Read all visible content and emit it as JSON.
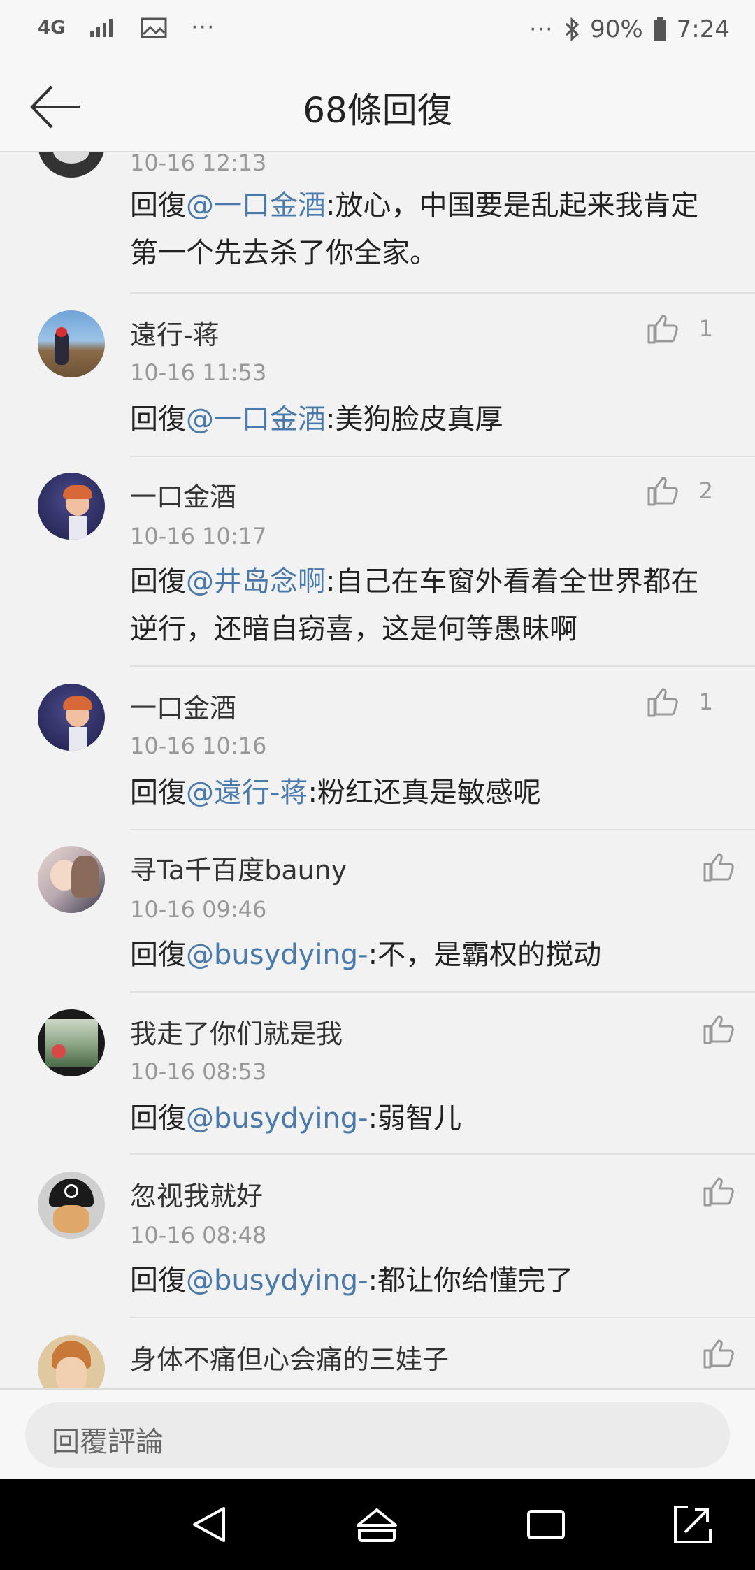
{
  "status": {
    "network": "4G",
    "left_dots": "···",
    "right_dots": "···",
    "battery": "90%",
    "time": "7:24"
  },
  "header": {
    "title": "68條回復"
  },
  "comments": [
    {
      "name": "",
      "time": "10-16 12:13",
      "reply_prefix": "回復",
      "mention": "@一口金酒",
      "text": ":放心，中国要是乱起来我肯定第一个先去杀了你全家。",
      "likes": ""
    },
    {
      "name": "遠行-蒋",
      "time": "10-16 11:53",
      "reply_prefix": "回復",
      "mention": "@一口金酒",
      "text": ":美狗脸皮真厚",
      "likes": "1"
    },
    {
      "name": "一口金酒",
      "time": "10-16 10:17",
      "reply_prefix": "回復",
      "mention": "@井岛念啊",
      "text": ":自己在车窗外看着全世界都在逆行，还暗自窃喜，这是何等愚昧啊",
      "likes": "2"
    },
    {
      "name": "一口金酒",
      "time": "10-16 10:16",
      "reply_prefix": "回復",
      "mention": "@遠行-蒋",
      "text": ":粉红还真是敏感呢",
      "likes": "1"
    },
    {
      "name": "寻Ta千百度bauny",
      "time": "10-16 09:46",
      "reply_prefix": "回復",
      "mention": "@busydying-",
      "text": ":不，是霸权的搅动",
      "likes": ""
    },
    {
      "name": "我走了你们就是我",
      "time": "10-16 08:53",
      "reply_prefix": "回復",
      "mention": "@busydying-",
      "text": ":弱智儿",
      "likes": ""
    },
    {
      "name": "忽视我就好",
      "time": "10-16 08:48",
      "reply_prefix": "回復",
      "mention": "@busydying-",
      "text": ":都让你给懂完了",
      "likes": ""
    },
    {
      "name": "身体不痛但心会痛的三娃子",
      "time": "",
      "reply_prefix": "",
      "mention": "",
      "text": "",
      "likes": ""
    }
  ],
  "input": {
    "placeholder": "回覆評論"
  },
  "colors": {
    "mention": "#4a7aab",
    "accent_bg": "#f2f2f2"
  },
  "icons": [
    "back-arrow-icon",
    "thumbs-up-icon",
    "nav-back-icon",
    "nav-home-icon",
    "nav-recents-icon",
    "nav-rotate-icon"
  ]
}
